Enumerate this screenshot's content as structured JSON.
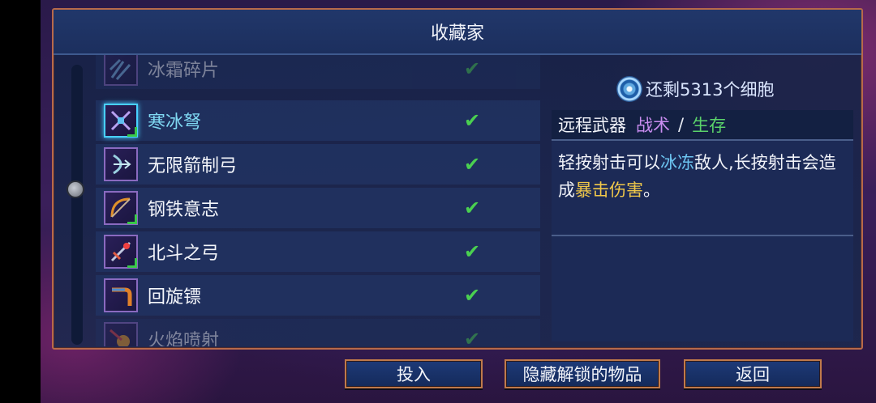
{
  "panel": {
    "title": "收藏家"
  },
  "list": {
    "items": [
      {
        "name": "冰霜碎片",
        "state": "faded",
        "icon": "frost-shards-icon"
      },
      {
        "name": "寒冰弩",
        "state": "selected",
        "icon": "ice-crossbow-icon"
      },
      {
        "name": "无限箭制弓",
        "state": "normal",
        "icon": "infinite-arrow-bow-icon"
      },
      {
        "name": "钢铁意志",
        "state": "normal",
        "icon": "iron-will-icon"
      },
      {
        "name": "北斗之弓",
        "state": "normal",
        "icon": "big-dipper-bow-icon"
      },
      {
        "name": "回旋镖",
        "state": "normal",
        "icon": "boomerang-icon"
      },
      {
        "name": "火焰喷射",
        "state": "faded",
        "icon": "flamethrower-icon"
      }
    ],
    "check_glyph": "✔"
  },
  "detail": {
    "cells_text": "还剩5313个细胞",
    "category": "远程武器",
    "tag_tactic": "战术",
    "separator": "/",
    "tag_survival": "生存",
    "desc_part1": "轻按射击可以",
    "desc_freeze": "冰冻",
    "desc_part2": "敌人,长按射击会造成",
    "desc_crit": "暴击伤害",
    "desc_part3": "。"
  },
  "buttons": {
    "invest": "投入",
    "hide_unlocked": "隐藏解锁的物品",
    "back": "返回"
  }
}
